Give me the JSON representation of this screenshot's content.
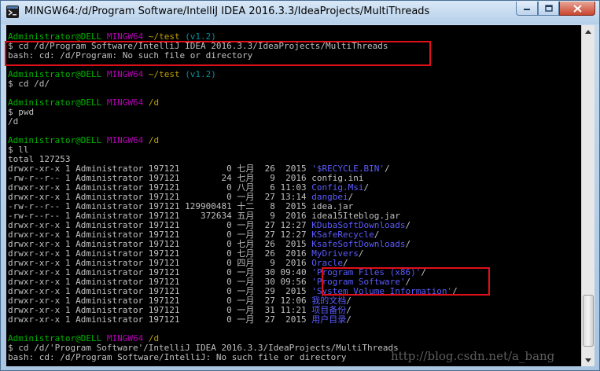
{
  "window": {
    "title": "MINGW64:/d/Program Software/IntelliJ IDEA 2016.3.3/IdeaProjects/MultiThreads"
  },
  "terminal": {
    "lines": [
      [
        {
          "t": "Administrator@DELL ",
          "c": "green"
        },
        {
          "t": "MINGW64 ",
          "c": "magenta"
        },
        {
          "t": "~/test ",
          "c": "yellow"
        },
        {
          "t": "(v1.2)",
          "c": "cyan"
        }
      ],
      [
        {
          "t": "$ cd /d/Program Software/IntelliJ IDEA 2016.3.3/IdeaProjects/MultiThreads",
          "c": "white"
        }
      ],
      [
        {
          "t": "bash: cd: /d/Program: No such file or directory",
          "c": "white"
        }
      ],
      [
        {
          "t": "",
          "c": "white"
        }
      ],
      [
        {
          "t": "Administrator@DELL ",
          "c": "green"
        },
        {
          "t": "MINGW64 ",
          "c": "magenta"
        },
        {
          "t": "~/test ",
          "c": "yellow"
        },
        {
          "t": "(v1.2)",
          "c": "cyan"
        }
      ],
      [
        {
          "t": "$ cd /d/",
          "c": "white"
        }
      ],
      [
        {
          "t": "",
          "c": "white"
        }
      ],
      [
        {
          "t": "Administrator@DELL ",
          "c": "green"
        },
        {
          "t": "MINGW64 ",
          "c": "magenta"
        },
        {
          "t": "/d",
          "c": "yellow"
        }
      ],
      [
        {
          "t": "$ pwd",
          "c": "white"
        }
      ],
      [
        {
          "t": "/d",
          "c": "white"
        }
      ],
      [
        {
          "t": "",
          "c": "white"
        }
      ],
      [
        {
          "t": "Administrator@DELL ",
          "c": "green"
        },
        {
          "t": "MINGW64 ",
          "c": "magenta"
        },
        {
          "t": "/d",
          "c": "yellow"
        }
      ],
      [
        {
          "t": "$ ll",
          "c": "white"
        }
      ],
      [
        {
          "t": "total 127253",
          "c": "white"
        }
      ],
      [
        {
          "t": "drwxr-xr-x 1 Administrator 197121         0 七月  26  2015 ",
          "c": "white"
        },
        {
          "t": "'$RECYCLE.BIN'",
          "c": "blue"
        },
        {
          "t": "/",
          "c": "white"
        }
      ],
      [
        {
          "t": "-rw-r--r-- 1 Administrator 197121        24 七月   9  2016 config.ini",
          "c": "white"
        }
      ],
      [
        {
          "t": "drwxr-xr-x 1 Administrator 197121         0 八月   6 11:03 ",
          "c": "white"
        },
        {
          "t": "Config.Msi",
          "c": "blue"
        },
        {
          "t": "/",
          "c": "white"
        }
      ],
      [
        {
          "t": "drwxr-xr-x 1 Administrator 197121         0 一月  27 13:14 ",
          "c": "white"
        },
        {
          "t": "dangbei",
          "c": "blue"
        },
        {
          "t": "/",
          "c": "white"
        }
      ],
      [
        {
          "t": "-rw-r--r-- 1 Administrator 197121 129900481 十二   8  2015 idea.jar",
          "c": "white"
        }
      ],
      [
        {
          "t": "-rw-r--r-- 1 Administrator 197121    372634 五月   9  2016 idea15Iteblog.jar",
          "c": "white"
        }
      ],
      [
        {
          "t": "drwxr-xr-x 1 Administrator 197121         0 一月  27 12:27 ",
          "c": "white"
        },
        {
          "t": "KDubaSoftDownloads",
          "c": "blue"
        },
        {
          "t": "/",
          "c": "white"
        }
      ],
      [
        {
          "t": "drwxr-xr-x 1 Administrator 197121         0 一月  27 12:27 ",
          "c": "white"
        },
        {
          "t": "KSafeRecycle",
          "c": "blue"
        },
        {
          "t": "/",
          "c": "white"
        }
      ],
      [
        {
          "t": "drwxr-xr-x 1 Administrator 197121         0 七月  26  2015 ",
          "c": "white"
        },
        {
          "t": "KsafeSoftDownloads",
          "c": "blue"
        },
        {
          "t": "/",
          "c": "white"
        }
      ],
      [
        {
          "t": "drwxr-xr-x 1 Administrator 197121         0 七月  26  2016 ",
          "c": "white"
        },
        {
          "t": "MyDrivers",
          "c": "blue"
        },
        {
          "t": "/",
          "c": "white"
        }
      ],
      [
        {
          "t": "drwxr-xr-x 1 Administrator 197121         0 四月   9  2016 ",
          "c": "white"
        },
        {
          "t": "Oracle",
          "c": "blue"
        },
        {
          "t": "/",
          "c": "white"
        }
      ],
      [
        {
          "t": "drwxr-xr-x 1 Administrator 197121         0 一月  30 09:40 ",
          "c": "white"
        },
        {
          "t": "'Program Files (x86)'",
          "c": "blue"
        },
        {
          "t": "/",
          "c": "white"
        }
      ],
      [
        {
          "t": "drwxr-xr-x 1 Administrator 197121         0 一月  30 09:56 ",
          "c": "white"
        },
        {
          "t": "'Program Software'",
          "c": "blue"
        },
        {
          "t": "/",
          "c": "white"
        }
      ],
      [
        {
          "t": "drwxr-xr-x 1 Administrator 197121         0 一月  29  2015 ",
          "c": "white"
        },
        {
          "t": "'System Volume Information'",
          "c": "blue"
        },
        {
          "t": "/",
          "c": "white"
        }
      ],
      [
        {
          "t": "drwxr-xr-x 1 Administrator 197121         0 一月  27 12:06 ",
          "c": "white"
        },
        {
          "t": "我的文档",
          "c": "blue"
        },
        {
          "t": "/",
          "c": "white"
        }
      ],
      [
        {
          "t": "drwxr-xr-x 1 Administrator 197121         0 一月  31 11:21 ",
          "c": "white"
        },
        {
          "t": "项目备份",
          "c": "blue"
        },
        {
          "t": "/",
          "c": "white"
        }
      ],
      [
        {
          "t": "drwxr-xr-x 1 Administrator 197121         0 一月  27  2015 ",
          "c": "white"
        },
        {
          "t": "用户目录",
          "c": "blue"
        },
        {
          "t": "/",
          "c": "white"
        }
      ],
      [
        {
          "t": "",
          "c": "white"
        }
      ],
      [
        {
          "t": "Administrator@DELL ",
          "c": "green"
        },
        {
          "t": "MINGW64 ",
          "c": "magenta"
        },
        {
          "t": "/d",
          "c": "yellow"
        }
      ],
      [
        {
          "t": "$ cd /d/'Program Software'/IntelliJ IDEA 2016.3.3/IdeaProjects/MultiThreads",
          "c": "white"
        }
      ],
      [
        {
          "t": "bash: cd: /d/Program Software/IntelliJ: No such file or directory",
          "c": "white"
        }
      ]
    ]
  },
  "watermark": "http://blog.csdn.net/a_bang",
  "colors": {
    "highlight": "#e0101a",
    "prompt_user": "#00b400",
    "prompt_env": "#b400b4",
    "prompt_path": "#c0a000",
    "directory": "#5b5bff"
  }
}
